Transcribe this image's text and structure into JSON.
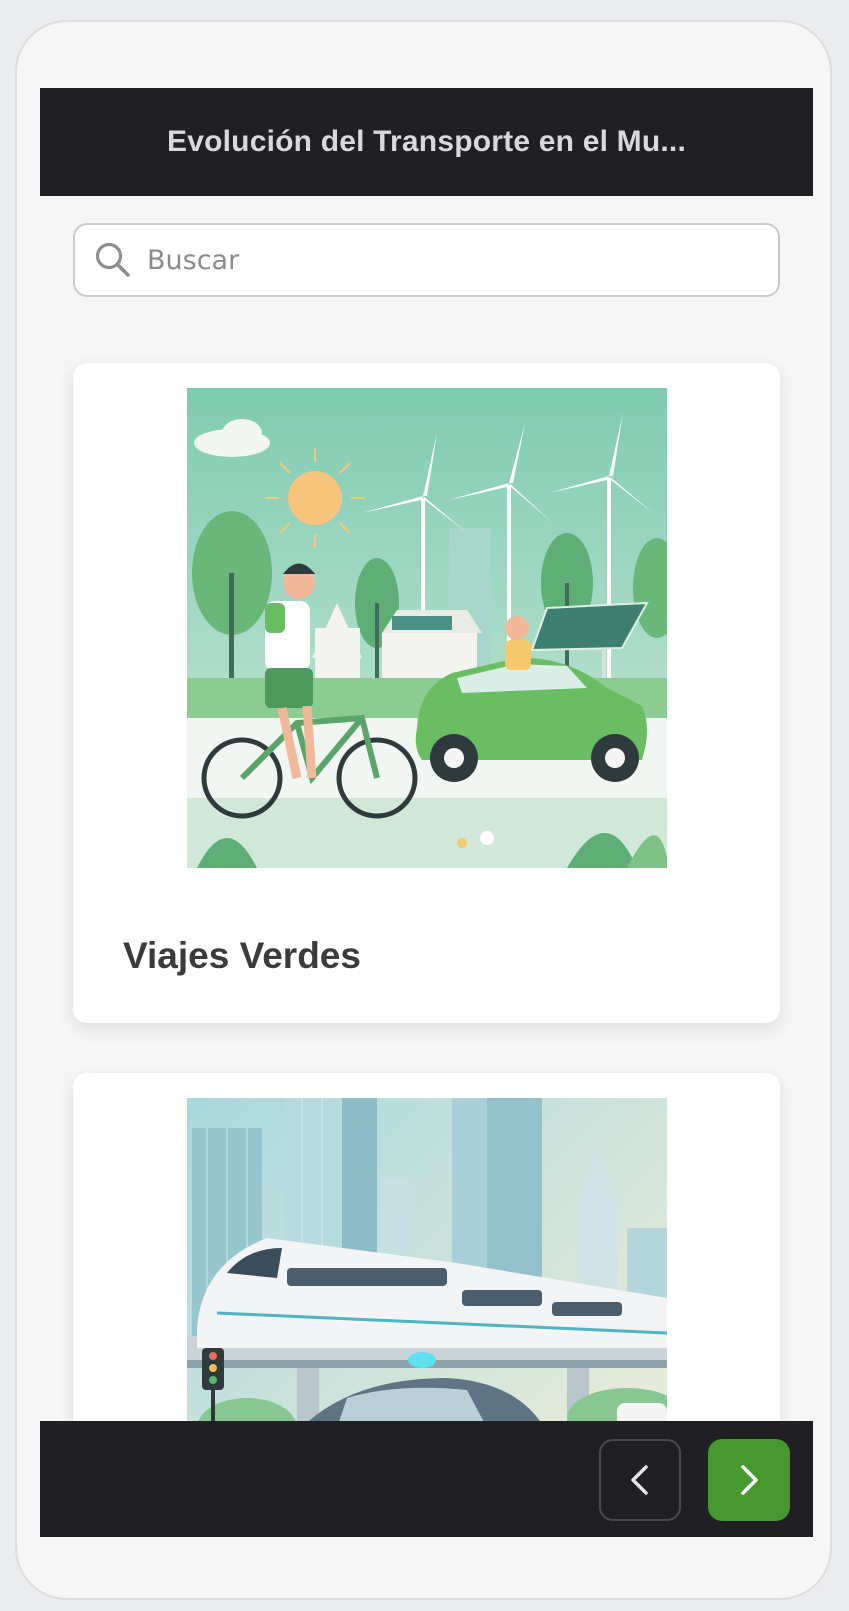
{
  "header": {
    "title": "Evolución del Transporte en el Mu..."
  },
  "search": {
    "placeholder": "Buscar",
    "icon": "search-icon"
  },
  "cards": [
    {
      "title": "Viajes Verdes",
      "image": "illustration of a cyclist and an electric car with wind turbines and solar panels"
    },
    {
      "title": "",
      "image": "illustration of a high-speed train on an elevated track in a modern city"
    }
  ],
  "footer": {
    "prev_icon": "chevron-left-icon",
    "next_icon": "chevron-right-icon"
  },
  "colors": {
    "bar_background": "#202024",
    "accent_green": "#46982f",
    "card_background": "#ffffff"
  }
}
